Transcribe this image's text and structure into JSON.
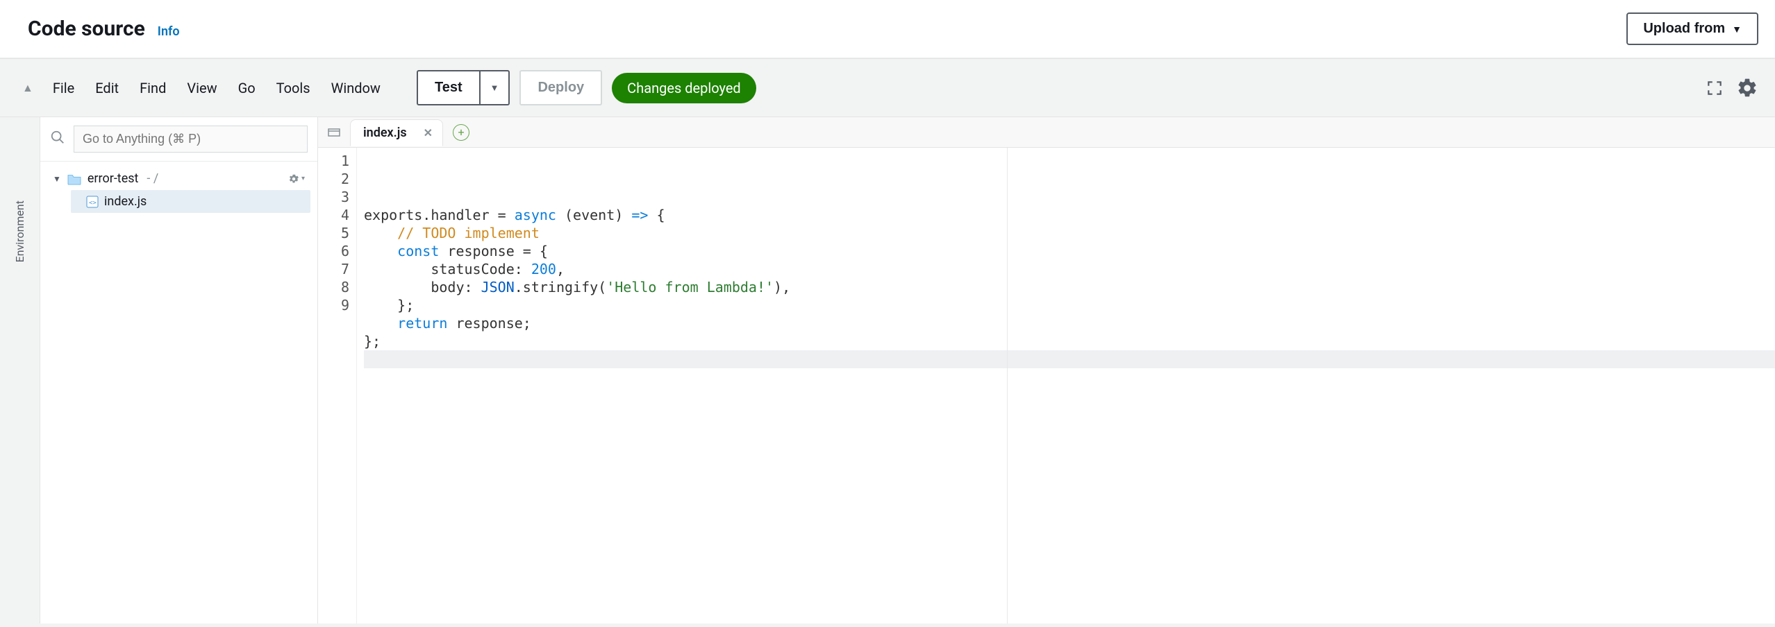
{
  "header": {
    "title": "Code source",
    "info": "Info",
    "upload_label": "Upload from"
  },
  "menubar": {
    "items": [
      "File",
      "Edit",
      "Find",
      "View",
      "Go",
      "Tools",
      "Window"
    ],
    "test_label": "Test",
    "deploy_label": "Deploy",
    "status_badge": "Changes deployed"
  },
  "sidebar": {
    "env_tab_label": "Environment",
    "search_placeholder": "Go to Anything (⌘ P)",
    "folder": {
      "name": "error-test",
      "path_suffix": " - /"
    },
    "files": [
      {
        "name": "index.js"
      }
    ]
  },
  "editor": {
    "active_tab": "index.js",
    "line_count": 9,
    "code_tokens": [
      [
        {
          "t": "punc",
          "v": "exports.handler "
        },
        {
          "t": "punc",
          "v": "= "
        },
        {
          "t": "kw",
          "v": "async"
        },
        {
          "t": "punc",
          "v": " (event) "
        },
        {
          "t": "arrow",
          "v": "=>"
        },
        {
          "t": "punc",
          "v": " {"
        }
      ],
      [
        {
          "t": "indent",
          "v": "    "
        },
        {
          "t": "comment",
          "v": "// TODO implement"
        }
      ],
      [
        {
          "t": "indent",
          "v": "    "
        },
        {
          "t": "kw",
          "v": "const"
        },
        {
          "t": "punc",
          "v": " response = {"
        }
      ],
      [
        {
          "t": "indent",
          "v": "        "
        },
        {
          "t": "punc",
          "v": "statusCode: "
        },
        {
          "t": "num",
          "v": "200"
        },
        {
          "t": "punc",
          "v": ","
        }
      ],
      [
        {
          "t": "indent",
          "v": "        "
        },
        {
          "t": "punc",
          "v": "body: "
        },
        {
          "t": "glob",
          "v": "JSON"
        },
        {
          "t": "punc",
          "v": ".stringify("
        },
        {
          "t": "str",
          "v": "'Hello from Lambda!'"
        },
        {
          "t": "punc",
          "v": "),"
        }
      ],
      [
        {
          "t": "indent",
          "v": "    "
        },
        {
          "t": "punc",
          "v": "};"
        }
      ],
      [
        {
          "t": "indent",
          "v": "    "
        },
        {
          "t": "kw",
          "v": "return"
        },
        {
          "t": "punc",
          "v": " response;"
        }
      ],
      [
        {
          "t": "punc",
          "v": "};"
        }
      ],
      []
    ]
  }
}
